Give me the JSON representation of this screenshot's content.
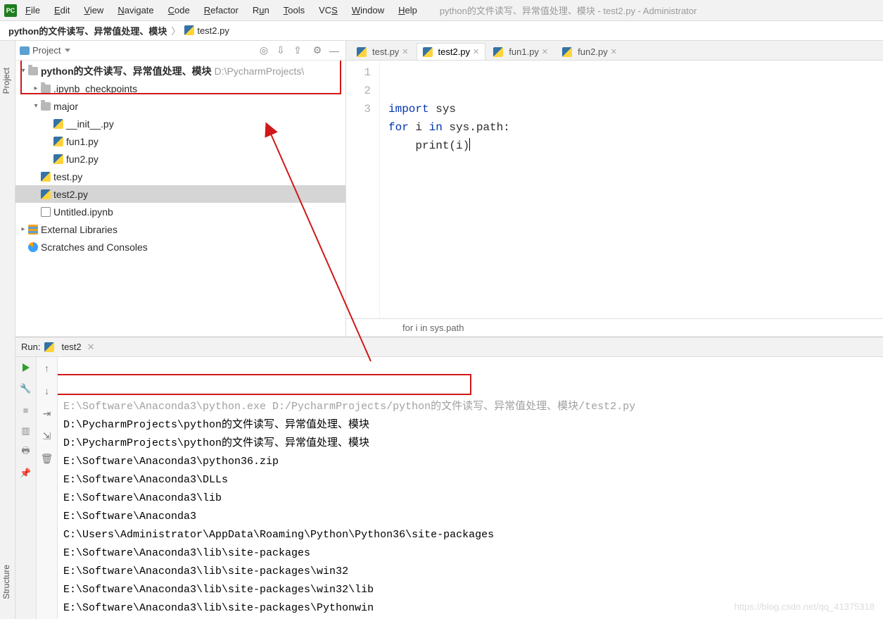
{
  "window": {
    "title": "python的文件读写、异常值处理、模块 - test2.py - Administrator"
  },
  "menu": {
    "items": [
      "File",
      "Edit",
      "View",
      "Navigate",
      "Code",
      "Refactor",
      "Run",
      "Tools",
      "VCS",
      "Window",
      "Help"
    ]
  },
  "breadcrumb": {
    "project": "python的文件读写、异常值处理、模块",
    "file": "test2.py"
  },
  "projectPanel": {
    "title": "Project",
    "rootName": "python的文件读写、异常值处理、模块",
    "rootPath": "D:\\PycharmProjects\\",
    "tree": {
      "ipynb": ".ipynb_checkpoints",
      "major": "major",
      "init": "__init__.py",
      "fun1": "fun1.py",
      "fun2": "fun2.py",
      "test": "test.py",
      "test2": "test2.py",
      "untitled": "Untitled.ipynb"
    },
    "external": "External Libraries",
    "scratches": "Scratches and Consoles"
  },
  "editor": {
    "tabs": [
      {
        "name": "test.py",
        "active": false
      },
      {
        "name": "test2.py",
        "active": true
      },
      {
        "name": "fun1.py",
        "active": false
      },
      {
        "name": "fun2.py",
        "active": false
      }
    ],
    "code": {
      "l1a": "import",
      "l1b": " sys",
      "l2a": "for",
      "l2b": " i ",
      "l2c": "in",
      "l2d": " sys.path:",
      "l3a": "    print",
      "l3b": "(",
      "l3c": "i",
      "l3d": ")"
    },
    "lineNumbers": [
      "1",
      "2",
      "3"
    ],
    "status": "for i in sys.path"
  },
  "run": {
    "label": "Run:",
    "configName": "test2",
    "lines": [
      "E:\\Software\\Anaconda3\\python.exe D:/PycharmProjects/python的文件读写、异常值处理、模块/test2.py",
      "D:\\PycharmProjects\\python的文件读写、异常值处理、模块",
      "D:\\PycharmProjects\\python的文件读写、异常值处理、模块",
      "E:\\Software\\Anaconda3\\python36.zip",
      "E:\\Software\\Anaconda3\\DLLs",
      "E:\\Software\\Anaconda3\\lib",
      "E:\\Software\\Anaconda3",
      "C:\\Users\\Administrator\\AppData\\Roaming\\Python\\Python36\\site-packages",
      "E:\\Software\\Anaconda3\\lib\\site-packages",
      "E:\\Software\\Anaconda3\\lib\\site-packages\\win32",
      "E:\\Software\\Anaconda3\\lib\\site-packages\\win32\\lib",
      "E:\\Software\\Anaconda3\\lib\\site-packages\\Pythonwin"
    ]
  },
  "sidebarTabs": {
    "project": "Project",
    "structure": "Structure"
  },
  "watermark": "https://blog.csdn.net/qq_41375318"
}
